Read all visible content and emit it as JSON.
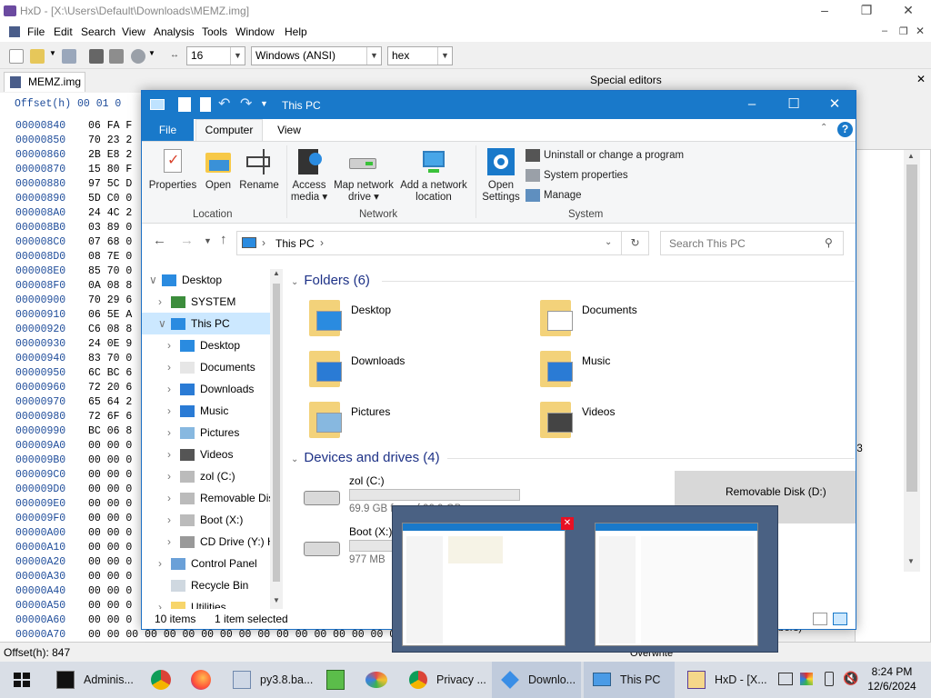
{
  "hxd": {
    "title": "HxD - [X:\\Users\\Default\\Downloads\\MEMZ.img]",
    "menu": [
      "File",
      "Edit",
      "Search",
      "View",
      "Analysis",
      "Tools",
      "Window",
      "Help"
    ],
    "toolbar": {
      "bytes_per_row": "16",
      "charset": "Windows (ANSI)",
      "offset_base": "hex"
    },
    "tab": "MEMZ.img",
    "special_editors": "Special editors",
    "hex_header": "Offset(h)  00 01 0",
    "rows": [
      {
        "off": "00000840",
        "bytes": "06 FA F"
      },
      {
        "off": "00000850",
        "bytes": "70 23 2"
      },
      {
        "off": "00000860",
        "bytes": "2B E8 2"
      },
      {
        "off": "00000870",
        "bytes": "15 80 F"
      },
      {
        "off": "00000880",
        "bytes": "97 5C D"
      },
      {
        "off": "00000890",
        "bytes": "5D C0 0"
      },
      {
        "off": "000008A0",
        "bytes": "24 4C 2"
      },
      {
        "off": "000008B0",
        "bytes": "03 89 0"
      },
      {
        "off": "000008C0",
        "bytes": "07 68 0"
      },
      {
        "off": "000008D0",
        "bytes": "08 7E 0"
      },
      {
        "off": "000008E0",
        "bytes": "85 70 0"
      },
      {
        "off": "000008F0",
        "bytes": "0A 08 8"
      },
      {
        "off": "00000900",
        "bytes": "70 29 6"
      },
      {
        "off": "00000910",
        "bytes": "06 5E A"
      },
      {
        "off": "00000920",
        "bytes": "C6 08 8"
      },
      {
        "off": "00000930",
        "bytes": "24 0E 9"
      },
      {
        "off": "00000940",
        "bytes": "83 70 0"
      },
      {
        "off": "00000950",
        "bytes": "6C BC 6"
      },
      {
        "off": "00000960",
        "bytes": "72 20 6"
      },
      {
        "off": "00000970",
        "bytes": "65 64 2"
      },
      {
        "off": "00000980",
        "bytes": "72 6F 6"
      },
      {
        "off": "00000990",
        "bytes": "BC 06 8"
      },
      {
        "off": "000009A0",
        "bytes": "00 00 0"
      },
      {
        "off": "000009B0",
        "bytes": "00 00 0"
      },
      {
        "off": "000009C0",
        "bytes": "00 00 0"
      },
      {
        "off": "000009D0",
        "bytes": "00 00 0"
      },
      {
        "off": "000009E0",
        "bytes": "00 00 0"
      },
      {
        "off": "000009F0",
        "bytes": "00 00 0"
      },
      {
        "off": "00000A00",
        "bytes": "00 00 0"
      },
      {
        "off": "00000A10",
        "bytes": "00 00 0"
      },
      {
        "off": "00000A20",
        "bytes": "00 00 0"
      },
      {
        "off": "00000A30",
        "bytes": "00 00 0"
      },
      {
        "off": "00000A40",
        "bytes": "00 00 0"
      },
      {
        "off": "00000A50",
        "bytes": "00 00 0"
      },
      {
        "off": "00000A60",
        "bytes": "00 00 0"
      },
      {
        "off": "00000A70",
        "bytes": "00 00 00 00 00 00 00 00 00 00 00 00 00 00 00 00 00 00 00"
      }
    ],
    "side_frag1": "9",
    "side_frag2": "03",
    "side_frag3": "bers)",
    "overwrite": "Overwrite",
    "status_offset": "Offset(h): 847"
  },
  "explorer": {
    "title": "This PC",
    "tabs": {
      "file": "File",
      "computer": "Computer",
      "view": "View"
    },
    "ribbon": {
      "properties": "Properties",
      "open": "Open",
      "rename": "Rename",
      "access_media_1": "Access",
      "access_media_2": "media ▾",
      "map_drive_1": "Map network",
      "map_drive_2": "drive ▾",
      "add_location_1": "Add a network",
      "add_location_2": "location",
      "open_settings_1": "Open",
      "open_settings_2": "Settings",
      "uninstall": "Uninstall or change a program",
      "system_properties": "System properties",
      "manage": "Manage",
      "grp_location": "Location",
      "grp_network": "Network",
      "grp_system": "System"
    },
    "address": "This PC",
    "search_placeholder": "Search This PC",
    "nav": [
      {
        "label": "Desktop"
      },
      {
        "label": "SYSTEM"
      },
      {
        "label": "This PC"
      },
      {
        "label": "Desktop"
      },
      {
        "label": "Documents"
      },
      {
        "label": "Downloads"
      },
      {
        "label": "Music"
      },
      {
        "label": "Pictures"
      },
      {
        "label": "Videos"
      },
      {
        "label": "zol (C:)"
      },
      {
        "label": "Removable Dis"
      },
      {
        "label": "Boot (X:)"
      },
      {
        "label": "CD Drive (Y:) H"
      },
      {
        "label": "Control Panel"
      },
      {
        "label": "Recycle Bin"
      },
      {
        "label": "Utilities"
      }
    ],
    "folders_header": "Folders (6)",
    "folders": [
      "Desktop",
      "Documents",
      "Downloads",
      "Music",
      "Pictures",
      "Videos"
    ],
    "devices_header": "Devices and drives (4)",
    "drives": {
      "c_name": "zol (C:)",
      "c_size": "69.9 GB free of 99.9 GB",
      "boot_name": "Boot (X:)",
      "boot_size": "977 MB",
      "removable_name": "Removable Disk (D:)"
    },
    "status_items": "10 items",
    "status_selected": "1 item selected"
  },
  "taskbar": {
    "items": [
      {
        "label": "Adminis..."
      },
      {
        "label": "py3.8.ba..."
      },
      {
        "label": "Privacy ..."
      },
      {
        "label": "Downlo..."
      },
      {
        "label": "This PC"
      },
      {
        "label": "HxD - [X..."
      }
    ],
    "time": "8:24 PM",
    "date": "12/6/2024"
  },
  "colors": {
    "explorer_accent": "#1979ca",
    "hxd_offset": "#1e4c9a",
    "taskbar": "#d9dee6"
  }
}
